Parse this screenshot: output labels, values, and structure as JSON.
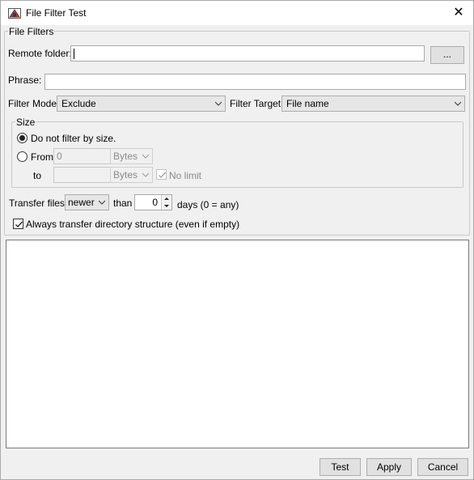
{
  "window": {
    "title": "File Filter Test"
  },
  "file_filters": {
    "legend": "File Filters",
    "remote_folder_label": "Remote folder:",
    "remote_folder_value": "",
    "browse_label": "...",
    "phrase_label": "Phrase:",
    "phrase_value": "",
    "filter_mode_label": "Filter Mode:",
    "filter_mode_value": "Exclude",
    "filter_target_label": "Filter Target:",
    "filter_target_value": "File name"
  },
  "size": {
    "legend": "Size",
    "no_filter_label": "Do not filter by size.",
    "from_label": "From",
    "from_value": "0",
    "from_unit": "Bytes",
    "to_label": "to",
    "to_value": "",
    "to_unit": "Bytes",
    "no_limit_label": "No limit"
  },
  "transfer": {
    "label": "Transfer files",
    "direction": "newer",
    "than_label": "than",
    "days_value": "0",
    "days_label": "days (0 = any)",
    "always_structure_label": "Always transfer directory structure (even if empty)"
  },
  "buttons": {
    "test": "Test",
    "apply": "Apply",
    "cancel": "Cancel"
  },
  "colors": {
    "accent": "#0078d7",
    "border": "#adadad",
    "background": "#f0f0f0"
  }
}
